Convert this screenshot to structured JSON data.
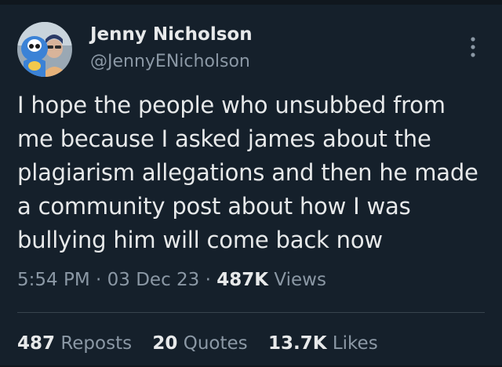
{
  "author": {
    "display_name": "Jenny Nicholson",
    "handle": "@JennyENicholson",
    "avatar_icon": "avatar-mascot-photo"
  },
  "tweet": {
    "lines": [
      "I hope the people who unsubbed from",
      "me because I asked james about the",
      "plagiarism allegations and then he made",
      "a community post about how I was",
      "bullying him will come back now"
    ]
  },
  "meta": {
    "time": "5:54 PM",
    "separator": "·",
    "date": "03 Dec 23",
    "views_count": "487K",
    "views_label": "Views"
  },
  "stats": {
    "reposts_count": "487",
    "reposts_label": "Reposts",
    "quotes_count": "20",
    "quotes_label": "Quotes",
    "likes_count": "13.7K",
    "likes_label": "Likes"
  },
  "icons": {
    "more": "more-options-icon"
  },
  "colors": {
    "background": "#15202b",
    "primary_text": "#e7e9ea",
    "secondary_text": "#8b98a5",
    "divider": "#38444d"
  }
}
